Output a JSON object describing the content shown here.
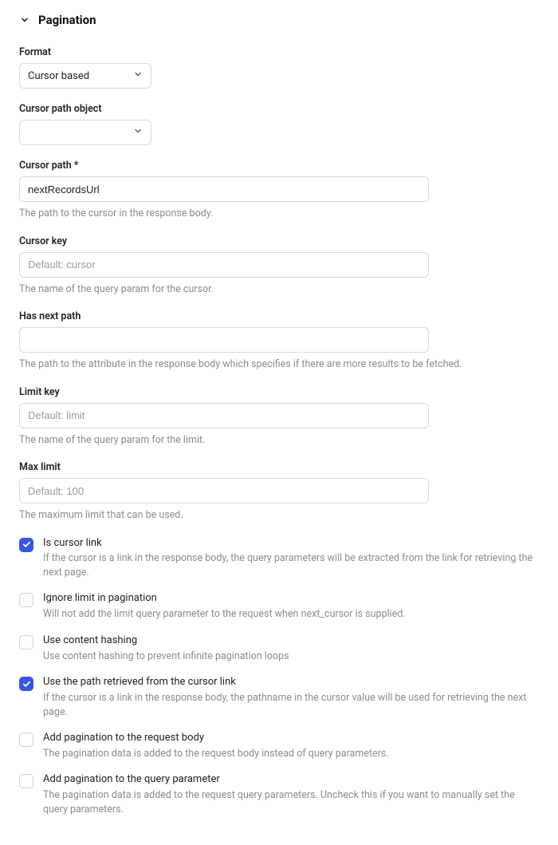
{
  "section": {
    "title": "Pagination"
  },
  "fields": {
    "format": {
      "label": "Format",
      "value": "Cursor based"
    },
    "cursor_path_object": {
      "label": "Cursor path object",
      "value": ""
    },
    "cursor_path": {
      "label": "Cursor path *",
      "value": "nextRecordsUrl",
      "help": "The path to the cursor in the response body."
    },
    "cursor_key": {
      "label": "Cursor key",
      "placeholder": "Default: cursor",
      "help": "The name of the query param for the cursor."
    },
    "has_next_path": {
      "label": "Has next path",
      "value": "",
      "help": "The path to the attribute in the response body which specifies if there are more results to be fetched."
    },
    "limit_key": {
      "label": "Limit key",
      "placeholder": "Default: limit",
      "help": "The name of the query param for the limit."
    },
    "max_limit": {
      "label": "Max limit",
      "placeholder": "Default: 100",
      "help": "The maximum limit that can be used."
    }
  },
  "checks": {
    "is_cursor_link": {
      "label": "Is cursor link",
      "help": "If the cursor is a link in the response body, the query parameters will be extracted from the link for retrieving the next page.",
      "checked": true
    },
    "ignore_limit": {
      "label": "Ignore limit in pagination",
      "help": "Will not add the limit query parameter to the request when next_cursor is supplied.",
      "checked": false
    },
    "content_hashing": {
      "label": "Use content hashing",
      "help": "Use content hashing to prevent infinite pagination loops",
      "checked": false
    },
    "use_path_from_cursor": {
      "label": "Use the path retrieved from the cursor link",
      "help": "If the cursor is a link in the response body, the pathname in the cursor value will be used for retrieving the next page.",
      "checked": true
    },
    "pagination_body": {
      "label": "Add pagination to the request body",
      "help": "The pagination data is added to the request body instead of query parameters.",
      "checked": false
    },
    "pagination_query": {
      "label": "Add pagination to the query parameter",
      "help": "The pagination data is added to the request query parameters. Uncheck this if you want to manually set the query parameters.",
      "checked": false
    }
  }
}
